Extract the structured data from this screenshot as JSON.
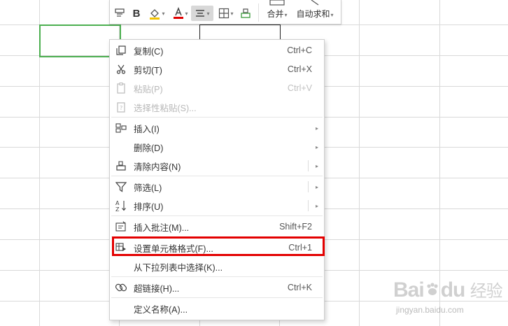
{
  "toolbar": {
    "merge_label": "合并",
    "autosum_label": "自动求和",
    "font_color": "#e00000",
    "fill_color": "#f3c300"
  },
  "menu": {
    "items": [
      {
        "label": "复制(C)",
        "shortcut": "Ctrl+C",
        "icon": "copy-icon",
        "disabled": false
      },
      {
        "label": "剪切(T)",
        "shortcut": "Ctrl+X",
        "icon": "scissors-icon",
        "disabled": false
      },
      {
        "label": "粘贴(P)",
        "shortcut": "Ctrl+V",
        "icon": "paste-icon",
        "disabled": true
      },
      {
        "label": "选择性粘贴(S)...",
        "shortcut": "",
        "icon": "paste-special-icon",
        "disabled": true
      },
      {
        "label": "插入(I)",
        "shortcut": "",
        "icon": "insert-icon",
        "disabled": false
      },
      {
        "label": "删除(D)",
        "shortcut": "",
        "icon": "",
        "disabled": false
      },
      {
        "label": "清除内容(N)",
        "shortcut": "",
        "icon": "eraser-icon",
        "disabled": false
      },
      {
        "label": "筛选(L)",
        "shortcut": "",
        "icon": "filter-icon",
        "disabled": false
      },
      {
        "label": "排序(U)",
        "shortcut": "",
        "icon": "sort-icon",
        "disabled": false
      },
      {
        "label": "插入批注(M)...",
        "shortcut": "Shift+F2",
        "icon": "comment-icon",
        "disabled": false
      },
      {
        "label": "设置单元格格式(F)...",
        "shortcut": "Ctrl+1",
        "icon": "format-cells-icon",
        "disabled": false
      },
      {
        "label": "从下拉列表中选择(K)...",
        "shortcut": "",
        "icon": "",
        "disabled": false
      },
      {
        "label": "超链接(H)...",
        "shortcut": "Ctrl+K",
        "icon": "link-icon",
        "disabled": false
      },
      {
        "label": "定义名称(A)...",
        "shortcut": "",
        "icon": "",
        "disabled": false
      }
    ],
    "highlight_color": "#e30000"
  },
  "watermark": {
    "brand": "Bai",
    "brand2": "du",
    "product": "经验",
    "url": "jingyan.baidu.com"
  }
}
